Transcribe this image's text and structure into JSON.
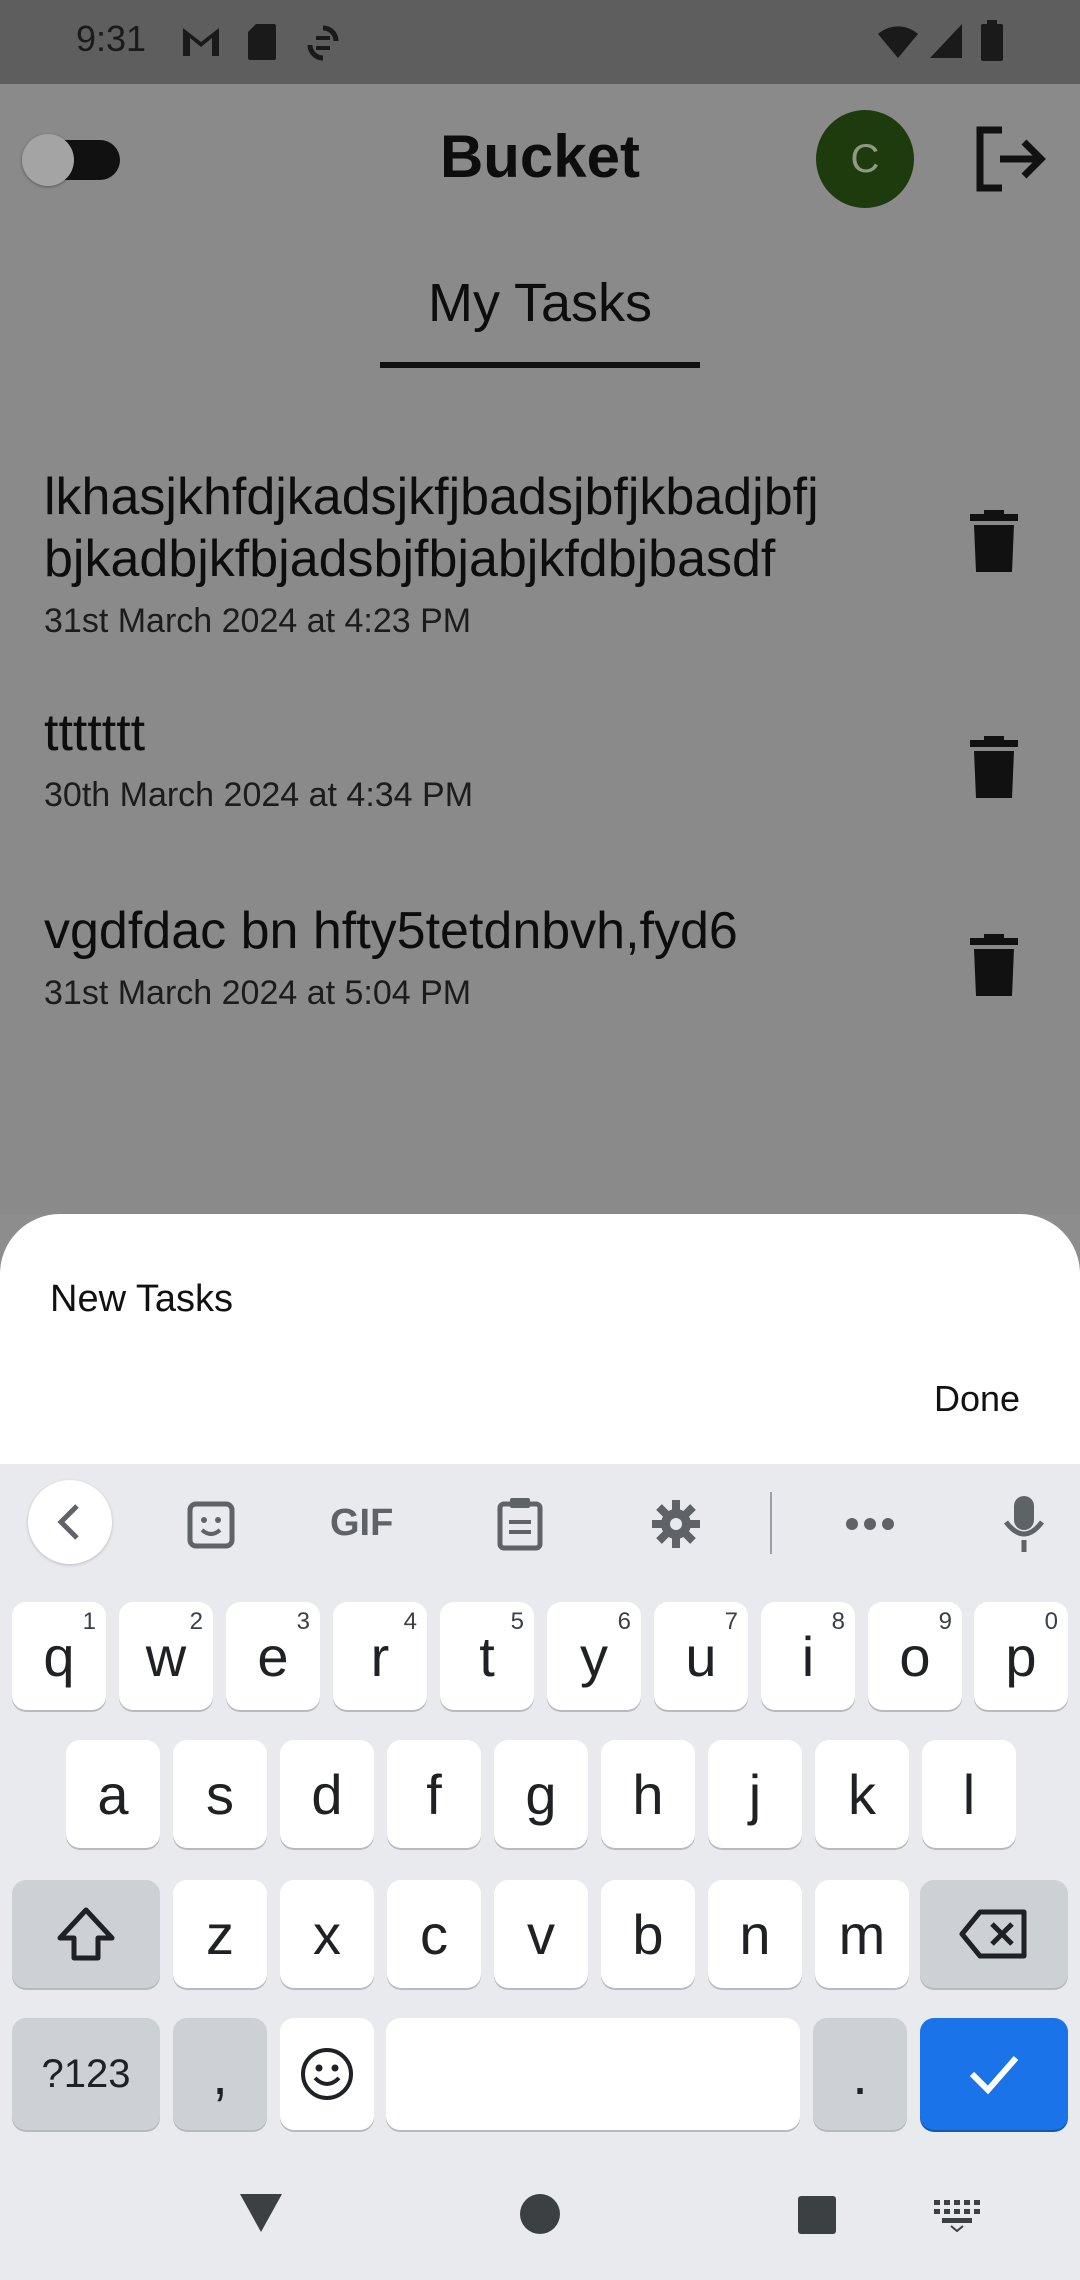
{
  "status_bar": {
    "time": "9:31"
  },
  "header": {
    "title": "Bucket",
    "avatar_initial": "C"
  },
  "tabs": [
    {
      "label": "My Tasks"
    }
  ],
  "tasks": [
    {
      "title_line1": "lkhasjkhfdjkadsjkfjbadsjbfjkbadjbfj",
      "title_line2": "bjkadbjkfbjadsbjfbjabjkfdbjbasdf",
      "date": "31st March 2024 at 4:23 PM"
    },
    {
      "title_line1": "ttttttt",
      "date": "30th March 2024 at 4:34 PM"
    },
    {
      "title_line1": "vgdfdac bn hfty5tetdnbvh,fyd6",
      "date": "31st March 2024 at 5:04 PM"
    }
  ],
  "sheet": {
    "title": "New Tasks",
    "done_label": "Done"
  },
  "keyboard": {
    "toolbar": {
      "gif_label": "GIF"
    },
    "row1": [
      {
        "key": "q",
        "hint": "1"
      },
      {
        "key": "w",
        "hint": "2"
      },
      {
        "key": "e",
        "hint": "3"
      },
      {
        "key": "r",
        "hint": "4"
      },
      {
        "key": "t",
        "hint": "5"
      },
      {
        "key": "y",
        "hint": "6"
      },
      {
        "key": "u",
        "hint": "7"
      },
      {
        "key": "i",
        "hint": "8"
      },
      {
        "key": "o",
        "hint": "9"
      },
      {
        "key": "p",
        "hint": "0"
      }
    ],
    "row2": [
      "a",
      "s",
      "d",
      "f",
      "g",
      "h",
      "j",
      "k",
      "l"
    ],
    "row3": [
      "z",
      "x",
      "c",
      "v",
      "b",
      "n",
      "m"
    ],
    "row4": {
      "symbols_label": "?123",
      "comma": ",",
      "period": "."
    }
  },
  "colors": {
    "accent": "#1a73e8",
    "avatar_bg": "#1d3b0d"
  }
}
